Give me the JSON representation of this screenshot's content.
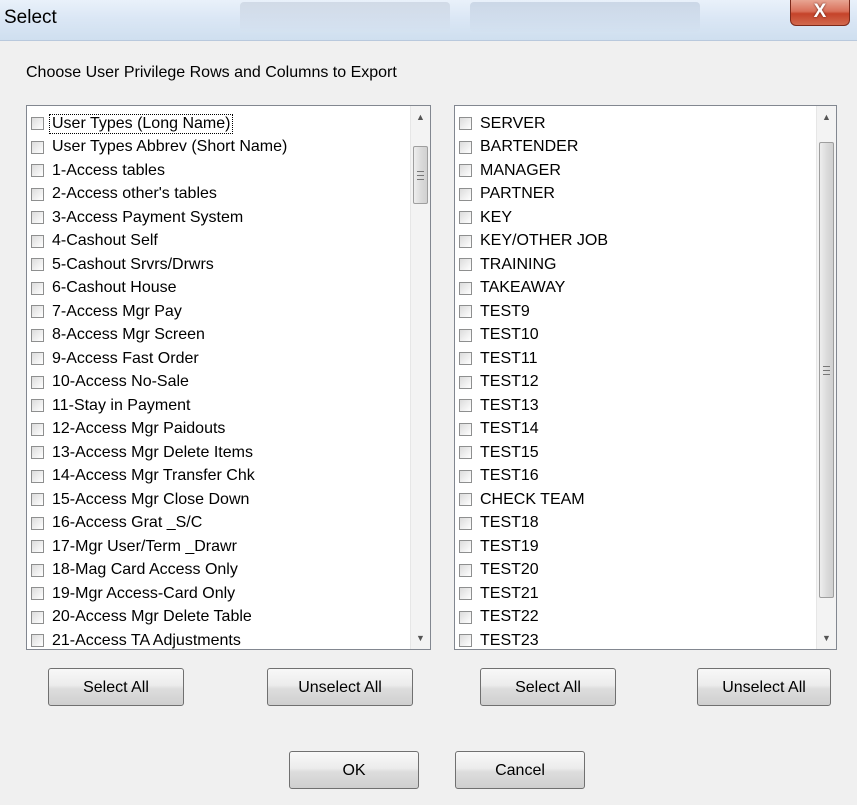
{
  "window": {
    "title": "Select",
    "close_glyph": "X"
  },
  "instruction": "Choose User Privilege Rows and Columns to Export",
  "left_list": {
    "items": [
      "User Types (Long Name)",
      "User Types Abbrev (Short Name)",
      "1-Access tables",
      "2-Access other's tables",
      "3-Access Payment System",
      "4-Cashout Self",
      "5-Cashout Srvrs/Drwrs",
      "6-Cashout House",
      "7-Access Mgr Pay",
      "8-Access Mgr Screen",
      "9-Access Fast Order",
      "10-Access No-Sale",
      "11-Stay in Payment",
      "12-Access Mgr Paidouts",
      "13-Access Mgr Delete Items",
      "14-Access Mgr Transfer Chk",
      "15-Access Mgr Close Down",
      "16-Access Grat _S/C",
      "17-Mgr User/Term _Drawr",
      "18-Mag Card Access Only",
      "19-Mgr Access-Card Only",
      "20-Access Mgr Delete Table",
      "21-Access TA Adjustments"
    ]
  },
  "right_list": {
    "items": [
      "SERVER",
      "BARTENDER",
      "MANAGER",
      "PARTNER",
      "KEY",
      "KEY/OTHER JOB",
      "TRAINING",
      "TAKEAWAY",
      "TEST9",
      "TEST10",
      "TEST11",
      "TEST12",
      "TEST13",
      "TEST14",
      "TEST15",
      "TEST16",
      "CHECK TEAM",
      "TEST18",
      "TEST19",
      "TEST20",
      "TEST21",
      "TEST22",
      "TEST23"
    ]
  },
  "buttons": {
    "left_select_all": "Select All",
    "left_unselect_all": "Unselect All",
    "right_select_all": "Select All",
    "right_unselect_all": "Unselect All",
    "ok": "OK",
    "cancel": "Cancel"
  },
  "icons": {
    "scroll_up": "up-arrow-icon",
    "scroll_down": "down-arrow-icon",
    "scroll_grip": "scroll-grip-icon",
    "close": "close-icon"
  }
}
